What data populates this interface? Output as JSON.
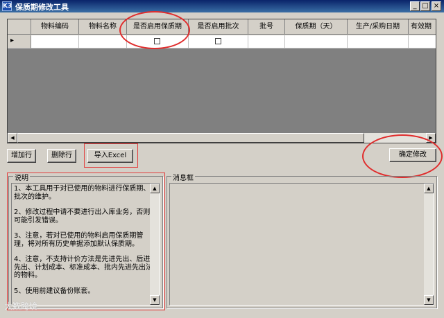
{
  "window": {
    "title": "保质期修改工具",
    "app_icon": "K3",
    "minimize": "_",
    "maximize": "□",
    "close": "×"
  },
  "grid": {
    "columns": [
      "物料编码",
      "物料名称",
      "是否启用保质期",
      "是否启用批次",
      "批号",
      "保质期（天）",
      "生产/采购日期",
      "有效期"
    ],
    "row_indicator": "▸",
    "rows": [
      {
        "物料编码": "",
        "物料名称": "",
        "是否启用保质期": false,
        "是否启用批次": false,
        "批号": "",
        "保质期（天）": "",
        "生产/采购日期": "",
        "有效期": ""
      }
    ]
  },
  "toolbar": {
    "add_row": "增加行",
    "delete_row": "删除行",
    "import_excel": "导入Excel",
    "confirm": "确定修改"
  },
  "description": {
    "label": "说明",
    "p1": "1、本工具用于对已使用的物料进行保质期、批次的维护。",
    "p2": "2、修改过程中请不要进行出入库业务，否则可能引发错误。",
    "p3": "3、注意，若对已使用的物料启用保质期管理，将对所有历史单据添加默认保质期。",
    "p4": "4、注意，不支持计价方法是先进先出、后进先出、计划成本、标准成本、批内先进先出法的物料。",
    "p5": "5、使用前建议备份账套。"
  },
  "messages": {
    "label": "消息框"
  },
  "watermark": "大数跨境",
  "colors": {
    "title_bar": "#0a246a",
    "annotation_red": "#e02d2d",
    "window_bg": "#d4d0c8"
  }
}
